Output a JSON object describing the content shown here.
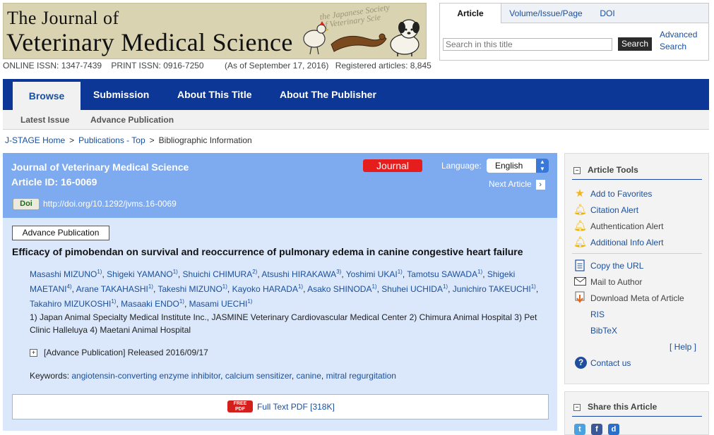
{
  "header": {
    "journal_title_line1": "The Journal of",
    "journal_title_line2": "Veterinary Medical Science",
    "society_line1": "the Japanese Society",
    "society_line2": "of Veterinary Scie",
    "online_issn": "ONLINE ISSN: 1347-7439",
    "print_issn": "PRINT ISSN: 0916-7250",
    "as_of": "(As of September 17, 2016)",
    "registered": "Registered articles: 8,845"
  },
  "search": {
    "tabs": [
      {
        "label": "Article",
        "active": true
      },
      {
        "label": "Volume/Issue/Page",
        "active": false
      },
      {
        "label": "DOI",
        "active": false
      }
    ],
    "placeholder": "Search in this title",
    "button": "Search",
    "advanced_line1": "Advanced",
    "advanced_line2": "Search"
  },
  "nav": {
    "tabs": [
      "Browse",
      "Submission",
      "About This Title",
      "About The Publisher"
    ],
    "subtabs": [
      "Latest Issue",
      "Advance Publication"
    ]
  },
  "breadcrumb": [
    "J-STAGE Home",
    "Publications - Top",
    "Bibliographic Information"
  ],
  "article": {
    "journal_name": "Journal of Veterinary Medical Science",
    "article_id": "Article ID: 16-0069",
    "badge": "Journal",
    "language_label": "Language:",
    "language_value": "English",
    "next_article": "Next Article",
    "doi_badge": "Doi",
    "doi_url": "http://doi.org/10.1292/jvms.16-0069",
    "status_label": "Advance Publication",
    "title": "Efficacy of pimobendan on survival and reoccurrence of pulmonary edema in canine congestive heart failure",
    "authors": [
      {
        "name": "Masashi MIZUNO",
        "aff": "1)"
      },
      {
        "name": "Shigeki YAMANO",
        "aff": "1)"
      },
      {
        "name": "Shuichi CHIMURA",
        "aff": "2)"
      },
      {
        "name": "Atsushi HIRAKAWA",
        "aff": "3)"
      },
      {
        "name": "Yoshimi UKAI",
        "aff": "1)"
      },
      {
        "name": "Tamotsu SAWADA",
        "aff": "1)"
      },
      {
        "name": "Shigeki MAETANI",
        "aff": "4)"
      },
      {
        "name": "Arane TAKAHASHI",
        "aff": "1)"
      },
      {
        "name": "Takeshi MIZUNO",
        "aff": "1)"
      },
      {
        "name": "Kayoko HARADA",
        "aff": "1)"
      },
      {
        "name": "Asako SHINODA",
        "aff": "1)"
      },
      {
        "name": "Shuhei UCHIDA",
        "aff": "1)"
      },
      {
        "name": "Junichiro TAKEUCHI",
        "aff": "1)"
      },
      {
        "name": "Takahiro MIZUKOSHI",
        "aff": "1)"
      },
      {
        "name": "Masaaki ENDO",
        "aff": "1)"
      },
      {
        "name": "Masami UECHI",
        "aff": "1)"
      }
    ],
    "affiliations": "1) Japan Animal Specialty Medical Institute Inc., JASMINE Veterinary Cardiovascular Medical Center 2) Chimura Animal Hospital 3) Pet Clinic Halleluya 4) Maetani Animal Hospital",
    "released": "[Advance Publication] Released 2016/09/17",
    "keywords_label": "Keywords:",
    "keywords": [
      "angiotensin-converting enzyme inhibitor",
      "calcium sensitizer",
      "canine",
      "mitral regurgitation"
    ],
    "pdf_icon_line1": "FREE",
    "pdf_icon_line2": "PDF",
    "pdf_link": "Full Text PDF [318K]"
  },
  "sidebar": {
    "tools_title": "Article Tools",
    "items": [
      {
        "label": "Add to Favorites",
        "icon": "star-icon"
      },
      {
        "label": "Citation Alert",
        "icon": "bell-icon"
      },
      {
        "label": "Authentication Alert",
        "icon": "bell-icon"
      },
      {
        "label": "Additional Info Alert",
        "icon": "bell-icon"
      },
      {
        "label": "Copy the URL",
        "icon": "document-icon"
      },
      {
        "label": "Mail to Author",
        "icon": "mail-icon"
      },
      {
        "label": "Download Meta of Article",
        "icon": "download-icon"
      }
    ],
    "ris": "RIS",
    "bibtex": "BibTeX",
    "help": "[ Help ]",
    "contact": "Contact us",
    "share_title": "Share this Article"
  },
  "colors": {
    "nav": "#0d3797",
    "panel_header": "#7eaaf0",
    "panel_body": "#dbe8fb",
    "journal_badge": "#e51d1d",
    "link": "#1a4f9c"
  }
}
